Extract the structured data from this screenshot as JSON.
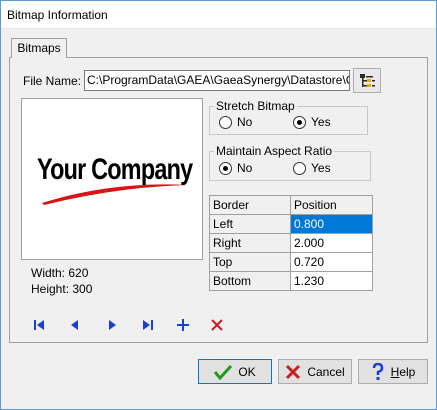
{
  "window": {
    "title": "Bitmap Information"
  },
  "tabs": [
    {
      "label": "Bitmaps"
    }
  ],
  "file": {
    "label": "File Name:",
    "value": "C:\\ProgramData\\GAEA\\GaeaSynergy\\Datastore\\C"
  },
  "preview": {
    "logo_text": "Your Company",
    "accent_color": "#d81414",
    "width_label": "Width: 620",
    "height_label": "Height: 300"
  },
  "stretch": {
    "legend": "Stretch Bitmap",
    "options": [
      {
        "label": "No",
        "checked": false
      },
      {
        "label": "Yes",
        "checked": true
      }
    ]
  },
  "aspect": {
    "legend": "Maintain Aspect Ratio",
    "options": [
      {
        "label": "No",
        "checked": true
      },
      {
        "label": "Yes",
        "checked": false
      }
    ]
  },
  "border_table": {
    "headers": [
      "Border",
      "Position"
    ],
    "rows": [
      {
        "border": "Left",
        "position": "0.800"
      },
      {
        "border": "Right",
        "position": "2.000"
      },
      {
        "border": "Top",
        "position": "0.720"
      },
      {
        "border": "Bottom",
        "position": "1.230"
      }
    ]
  },
  "navigator": {
    "icons": [
      "first-record-icon",
      "previous-record-icon",
      "next-record-icon",
      "last-record-icon",
      "add-record-icon",
      "delete-record-icon"
    ],
    "icon_color": "#1a3fd6",
    "delete_color": "#c81e1e"
  },
  "buttons": {
    "ok": "OK",
    "cancel": "Cancel",
    "help": "Help"
  }
}
